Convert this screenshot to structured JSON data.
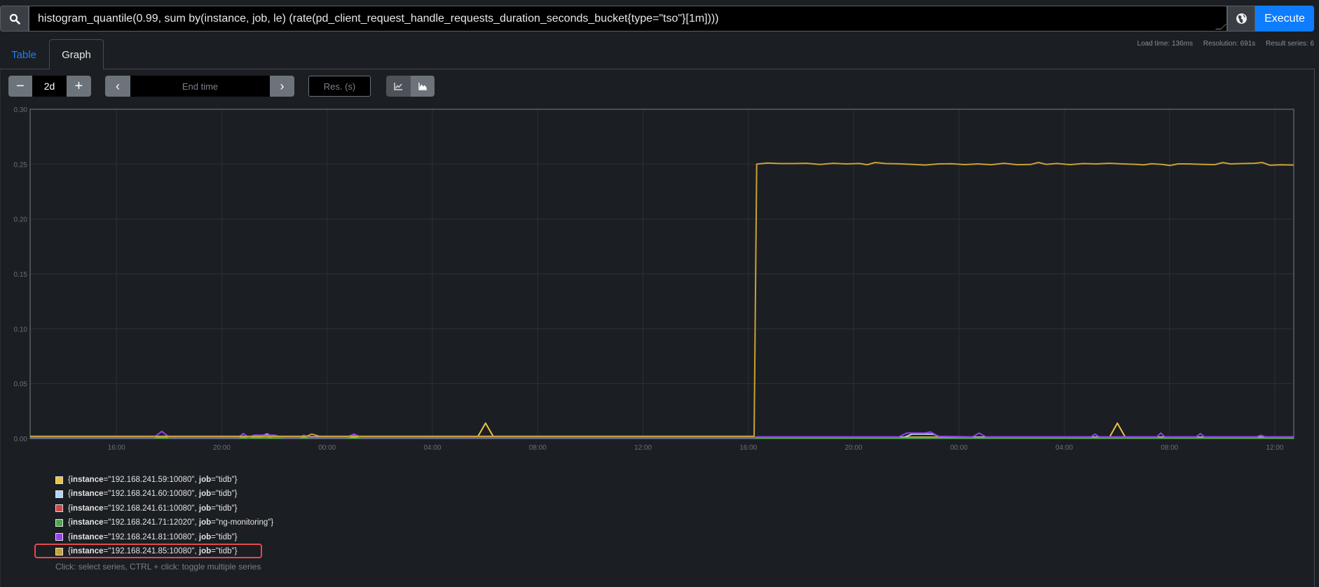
{
  "query": {
    "expression": "histogram_quantile(0.99, sum by(instance, job, le) (rate(pd_client_request_handle_requests_duration_seconds_bucket{type=\"tso\"}[1m])))",
    "search_icon": "search-icon",
    "globe_icon": "globe-icon",
    "execute_label": "Execute"
  },
  "stats": {
    "load_time": "Load time: 136ms",
    "resolution": "Resolution: 691s",
    "result_series": "Result series: 6"
  },
  "tabs": [
    {
      "label": "Table",
      "active": false
    },
    {
      "label": "Graph",
      "active": true
    }
  ],
  "controls": {
    "minus_label": "−",
    "range_value": "2d",
    "plus_label": "+",
    "prev_label": "‹",
    "end_time_placeholder": "End time",
    "next_label": "›",
    "resolution_placeholder": "Res. (s)",
    "line_icon": "line-chart-icon",
    "stacked_icon": "stacked-chart-icon"
  },
  "legend": {
    "highlight_color": "#e5484d",
    "help": "Click: select series, CTRL + click: toggle multiple series"
  },
  "chart_data": {
    "type": "line",
    "title": "",
    "xlabel": "",
    "ylabel": "",
    "x_unit": "hours since start of 2d range",
    "xlim": [
      0,
      48
    ],
    "ylim": [
      0,
      0.3
    ],
    "grid": true,
    "y_ticks": [
      "0.00",
      "0.05",
      "0.10",
      "0.15",
      "0.20",
      "0.25",
      "0.30"
    ],
    "x_ticks": [
      {
        "label": "16:00",
        "h": 3.28
      },
      {
        "label": "20:00",
        "h": 7.28
      },
      {
        "label": "00:00",
        "h": 11.28
      },
      {
        "label": "04:00",
        "h": 15.28
      },
      {
        "label": "08:00",
        "h": 19.28
      },
      {
        "label": "12:00",
        "h": 23.28
      },
      {
        "label": "16:00",
        "h": 27.28
      },
      {
        "label": "20:00",
        "h": 31.28
      },
      {
        "label": "00:00",
        "h": 35.28
      },
      {
        "label": "04:00",
        "h": 39.28
      },
      {
        "label": "08:00",
        "h": 43.28
      },
      {
        "label": "12:00",
        "h": 47.28
      }
    ],
    "series": [
      {
        "instance": "\"192.168.241.59:10080\"",
        "job": "\"tidb\"",
        "color": "#edc240",
        "highlighted": false,
        "points": [
          [
            0,
            0.0015
          ],
          [
            17.0,
            0.0015
          ],
          [
            17.3,
            0.014
          ],
          [
            17.6,
            0.0015
          ],
          [
            27.5,
            0.0012
          ],
          [
            41.0,
            0.0012
          ],
          [
            41.3,
            0.014
          ],
          [
            41.6,
            0.0012
          ],
          [
            48,
            0.0012
          ]
        ]
      },
      {
        "instance": "\"192.168.241.60:10080\"",
        "job": "\"tidb\"",
        "color": "#afd8f8",
        "highlighted": false,
        "points": [
          [
            0,
            0.001
          ],
          [
            8.6,
            0.001
          ],
          [
            9.0,
            0.004
          ],
          [
            9.3,
            0.001
          ],
          [
            33.2,
            0.001
          ],
          [
            33.5,
            0.004
          ],
          [
            34.3,
            0.004
          ],
          [
            34.6,
            0.001
          ],
          [
            48,
            0.001
          ]
        ]
      },
      {
        "instance": "\"192.168.241.61:10080\"",
        "job": "\"tidb\"",
        "color": "#cb4b4b",
        "highlighted": false,
        "points": [
          [
            0,
            0.0005
          ],
          [
            8.8,
            0.0005
          ],
          [
            9.1,
            0.002
          ],
          [
            9.5,
            0.0005
          ],
          [
            12.0,
            0.0005
          ],
          [
            12.3,
            0.003
          ],
          [
            12.6,
            0.0005
          ],
          [
            48,
            0.0005
          ]
        ]
      },
      {
        "instance": "\"192.168.241.71:12020\"",
        "job": "\"ng-monitoring\"",
        "color": "#4da74d",
        "highlighted": false,
        "points": [
          [
            0,
            0.0003
          ],
          [
            48,
            0.0003
          ]
        ]
      },
      {
        "instance": "\"192.168.241.81:10080\"",
        "job": "\"tidb\"",
        "color": "#9440ed",
        "highlighted": false,
        "points": [
          [
            0,
            0.0008
          ],
          [
            4.7,
            0.0008
          ],
          [
            5.0,
            0.0065
          ],
          [
            5.3,
            0.0008
          ],
          [
            7.9,
            0.0008
          ],
          [
            8.1,
            0.0045
          ],
          [
            8.3,
            0.0008
          ],
          [
            8.5,
            0.003
          ],
          [
            9.3,
            0.003
          ],
          [
            9.6,
            0.0008
          ],
          [
            10.2,
            0.0008
          ],
          [
            10.4,
            0.003
          ],
          [
            10.6,
            0.0008
          ],
          [
            12.0,
            0.0008
          ],
          [
            12.3,
            0.004
          ],
          [
            12.6,
            0.0008
          ],
          [
            27.5,
            0.0008
          ],
          [
            27.6,
            0.0015
          ],
          [
            33.0,
            0.0015
          ],
          [
            33.3,
            0.005
          ],
          [
            34.0,
            0.005
          ],
          [
            34.2,
            0.006
          ],
          [
            34.5,
            0.002
          ],
          [
            35.8,
            0.0015
          ],
          [
            36.05,
            0.005
          ],
          [
            36.3,
            0.0015
          ],
          [
            40.3,
            0.0015
          ],
          [
            40.45,
            0.004
          ],
          [
            40.6,
            0.0015
          ],
          [
            42.8,
            0.0015
          ],
          [
            42.95,
            0.005
          ],
          [
            43.1,
            0.0015
          ],
          [
            44.3,
            0.0015
          ],
          [
            44.45,
            0.0045
          ],
          [
            44.6,
            0.0015
          ],
          [
            46.6,
            0.0015
          ],
          [
            46.75,
            0.003
          ],
          [
            46.9,
            0.0015
          ],
          [
            48,
            0.0015
          ]
        ]
      },
      {
        "instance": "\"192.168.241.85:10080\"",
        "job": "\"tidb\"",
        "color": "#c9a132",
        "highlighted": true,
        "points": [
          [
            0,
            0.002
          ],
          [
            10.5,
            0.002
          ],
          [
            10.7,
            0.004
          ],
          [
            11.0,
            0.002
          ],
          [
            27.5,
            0.002
          ],
          [
            27.6,
            0.25
          ],
          [
            28.0,
            0.251
          ],
          [
            28.5,
            0.2505
          ],
          [
            29.0,
            0.2505
          ],
          [
            29.5,
            0.2508
          ],
          [
            30.0,
            0.2497
          ],
          [
            30.5,
            0.2508
          ],
          [
            31.0,
            0.2502
          ],
          [
            31.5,
            0.2506
          ],
          [
            31.8,
            0.2495
          ],
          [
            32.1,
            0.2515
          ],
          [
            32.5,
            0.2505
          ],
          [
            33.0,
            0.2503
          ],
          [
            33.5,
            0.2498
          ],
          [
            34.0,
            0.2492
          ],
          [
            34.5,
            0.2502
          ],
          [
            35.0,
            0.2504
          ],
          [
            35.5,
            0.2496
          ],
          [
            36.0,
            0.2502
          ],
          [
            36.5,
            0.2495
          ],
          [
            37.0,
            0.2508
          ],
          [
            37.5,
            0.2495
          ],
          [
            38.0,
            0.2497
          ],
          [
            38.3,
            0.2515
          ],
          [
            38.6,
            0.2498
          ],
          [
            39.0,
            0.2506
          ],
          [
            39.5,
            0.2496
          ],
          [
            40.0,
            0.2505
          ],
          [
            40.5,
            0.2502
          ],
          [
            41.0,
            0.2508
          ],
          [
            41.5,
            0.2502
          ],
          [
            42.0,
            0.2498
          ],
          [
            42.3,
            0.2493
          ],
          [
            42.6,
            0.2504
          ],
          [
            43.0,
            0.2497
          ],
          [
            43.3,
            0.2488
          ],
          [
            43.6,
            0.2502
          ],
          [
            44.0,
            0.2502
          ],
          [
            44.5,
            0.2498
          ],
          [
            45.0,
            0.2496
          ],
          [
            45.3,
            0.2514
          ],
          [
            45.6,
            0.2502
          ],
          [
            46.0,
            0.2505
          ],
          [
            46.5,
            0.2508
          ],
          [
            46.8,
            0.2515
          ],
          [
            47.1,
            0.249
          ],
          [
            47.5,
            0.2494
          ],
          [
            48,
            0.2492
          ]
        ]
      }
    ]
  }
}
